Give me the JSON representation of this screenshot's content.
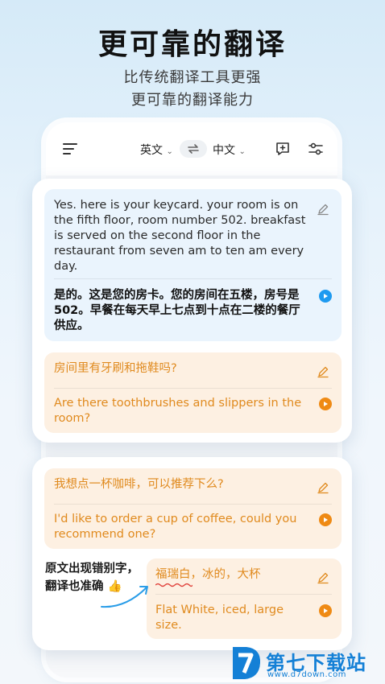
{
  "hero": {
    "title": "更可靠的翻译",
    "subtitle_line1": "比传统翻译工具更强",
    "subtitle_line2": "更可靠的翻译能力"
  },
  "toolbar": {
    "source_lang": "英文",
    "target_lang": "中文",
    "icons": [
      "menu-icon",
      "swap-icon",
      "add-note-icon",
      "settings-sliders-icon"
    ]
  },
  "card1": {
    "source_text": "Yes. here is your keycard. your room is on the fifth floor, room number 502. breakfast is served on the second floor in the restaurant from seven am to ten am every day.",
    "translation": "是的。这是您的房卡。您的房间在五楼，房号是502。早餐在每天早上七点到十点在二楼的餐厅供应。",
    "question": "房间里有牙刷和拖鞋吗?",
    "question_translation": "Are there toothbrushes and slippers in the room?"
  },
  "card2": {
    "question": "我想点一杯咖啡，可以推荐下么?",
    "question_translation": "I'd like to order a cup of coffee, could you recommend one?",
    "typo_source": "福瑞白，冰的，大杯",
    "typo_translation": "Flat White, iced, large size."
  },
  "callout": {
    "line1": "原文出现错别字，",
    "line2": "翻译也准确",
    "emoji": "👍"
  },
  "watermark": {
    "brand": "第七下载站",
    "url": "www.d7down.com"
  },
  "colors": {
    "accent_blue": "#1e9af0",
    "accent_orange": "#ef8a14",
    "bubble_blue": "#eaf4fd",
    "bubble_orange": "#fdf0e2"
  }
}
